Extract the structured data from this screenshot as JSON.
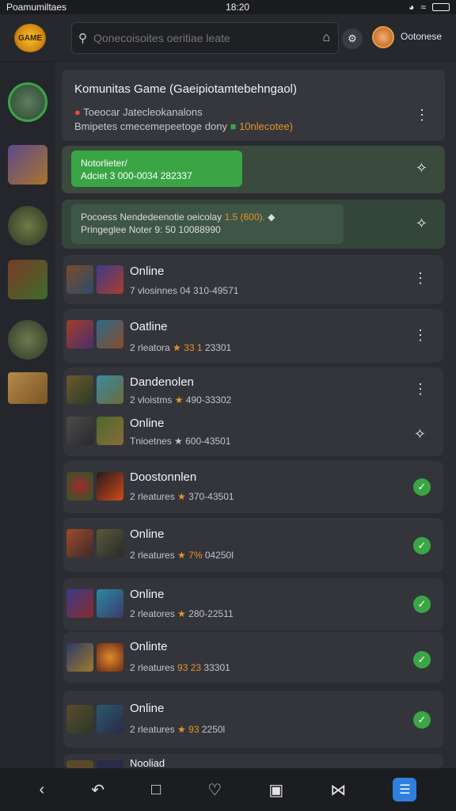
{
  "status": {
    "app": "Poamumiltaes",
    "time": "18:20",
    "icons": [
      "clock-icon",
      "wifi-icon",
      "battery-icon"
    ]
  },
  "topbar": {
    "search_placeholder": "Qonecoisoites oeritiae leate",
    "username": "Ootonese",
    "logo_text": "GAME"
  },
  "card_header": {
    "title": "Komunitas Game (Gaeipiotamtebehngaol)",
    "line1": "Toeocar Jatecleokanalons",
    "line2": "Bmipetes cmecemepeetoge dony",
    "line2_tag": "10nlecotee)"
  },
  "notif_card": {
    "title": "Notorlieter/",
    "sub": "Adciet 3 000-0034 282337"
  },
  "info_card": {
    "line1": "Pocoess Nendedeenotie oeicolay",
    "line1_tag": "1.5 (600).",
    "line2": "Pringeglee Noter 9: 50 10088990"
  },
  "rows": [
    {
      "title": "Online",
      "sub": "7 vlosinnes 04 310-49571",
      "hl": "",
      "action": "dots"
    },
    {
      "title": "Oatline",
      "sub": "2 rleatora",
      "hl": "★ 33 1",
      "sub_tail": "23301",
      "action": "dots"
    },
    {
      "title": "Dandenolen",
      "sub": "2 vloistms",
      "hl": "★",
      "sub_tail": "490-33302",
      "action": "dots"
    },
    {
      "title": "Online",
      "sub": "Tnioetnes ★ 600-43501",
      "hl": "",
      "action": "plus"
    },
    {
      "title": "Doostonnlen",
      "sub": "2 rleatures",
      "hl": "★",
      "sub_tail": "370-43501",
      "action": "check"
    },
    {
      "title": "Online",
      "sub": "2 rleatures",
      "hl": "★ 7%",
      "sub_tail": "04250l",
      "action": "check"
    },
    {
      "title": "Online",
      "sub": "2 rleatores",
      "hl": "★",
      "sub_tail": "280-22511",
      "action": "check"
    },
    {
      "title": "Onlinte",
      "sub": "2 rleatures",
      "hl": "93 23",
      "sub_tail": "33301",
      "action": "check"
    },
    {
      "title": "Online",
      "sub": "2 rleatures",
      "hl": "★ 93",
      "sub_tail": "2250l",
      "action": "check"
    },
    {
      "title": "Nooliad",
      "sub": "",
      "hl": "",
      "action": "none"
    }
  ],
  "nav": {
    "items": [
      "back-icon",
      "undo-icon",
      "square-icon",
      "heart-icon",
      "note-icon",
      "ribbon-icon",
      "apps-icon"
    ]
  },
  "colors": {
    "accent": "#3aa545",
    "highlight": "#e6932a",
    "nav_active": "#2f7fdc"
  }
}
